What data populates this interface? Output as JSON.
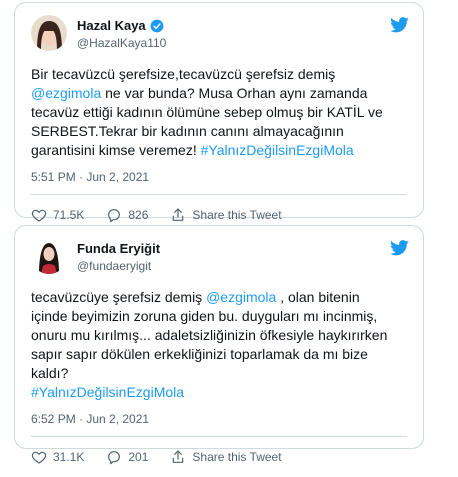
{
  "tweets": [
    {
      "name": "Hazal Kaya",
      "handle": "@HazalKaya110",
      "verified": true,
      "text_lines": [
        [
          "Bir tecavüzcü şerefsize,tecavüzcü şerefsiz demiş"
        ],
        [
          "@ezgimola",
          " ne var bunda? Musa Orhan aynı zamanda"
        ],
        [
          "tecavüz ettiği kadının ölümüne sebep olmuş bir KATİL ve"
        ],
        [
          "SERBEST.Tekrar bir kadının canını almayacağının"
        ],
        [
          "garantisini kimse veremez! ",
          "#YalnızDeğilsinEzgiMola"
        ]
      ],
      "time": "5:51 PM · Jun 2, 2021",
      "likes": "71.5K",
      "replies": "826",
      "share": "Share this Tweet"
    },
    {
      "name": "Funda Eryiğit",
      "handle": "@fundaeryigit",
      "verified": false,
      "text_lines": [
        [
          "tecavüzcüye şerefsiz demiş ",
          "@ezgimola",
          " , olan bitenin"
        ],
        [
          "içinde beyimizin zoruna giden bu. duyguları mı incinmiş,"
        ],
        [
          "onuru mu kırılmış... adaletsizliğinizin öfkesiyle haykırırken"
        ],
        [
          "sapır sapır dökülen erkekliğinizi toparlamak da mı bize"
        ],
        [
          "kaldı?"
        ],
        [
          "#YalnızDeğilsinEzgiMola"
        ]
      ],
      "time": "6:52 PM · Jun 2, 2021",
      "likes": "31.1K",
      "replies": "201",
      "share": "Share this Tweet"
    }
  ],
  "icons": {
    "brand": "twitter-bird-icon",
    "like": "heart-icon",
    "reply": "reply-icon",
    "share": "share-icon",
    "verified": "verified-badge-icon"
  },
  "colors": {
    "link": "#1d9bf0",
    "muted": "#536471",
    "border": "#cfd9de",
    "text": "#0f1419"
  }
}
